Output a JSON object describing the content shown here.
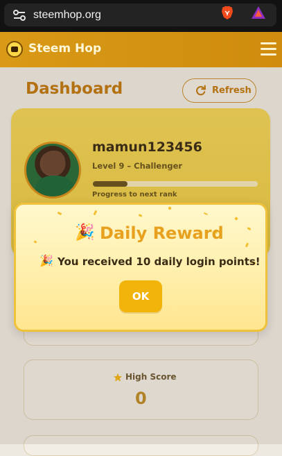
{
  "browser": {
    "url": "steemhop.org"
  },
  "header": {
    "app_title": "Steem Hop"
  },
  "dashboard": {
    "title": "Dashboard",
    "refresh_label": "Refresh"
  },
  "profile": {
    "username": "mamun123456",
    "level": "Level 9 – Challenger",
    "progress_label": "Progress to next rank",
    "progress_percent": 21
  },
  "stats": {
    "high_score_label": "High Score",
    "high_score_value": "0"
  },
  "modal": {
    "title": "Daily Reward",
    "message": "You received 10 daily login points!",
    "ok_label": "OK"
  },
  "colors": {
    "accent": "#d99a17",
    "gold": "#f2b40b",
    "text_dark": "#3a2b14"
  },
  "icons": {
    "site_settings": "site-settings-icon",
    "brave": "brave-lion-icon",
    "rewards": "rewards-triangle-icon",
    "menu": "hamburger-menu-icon",
    "refresh": "refresh-icon",
    "star": "star-icon",
    "party": "party-popper-icon"
  }
}
